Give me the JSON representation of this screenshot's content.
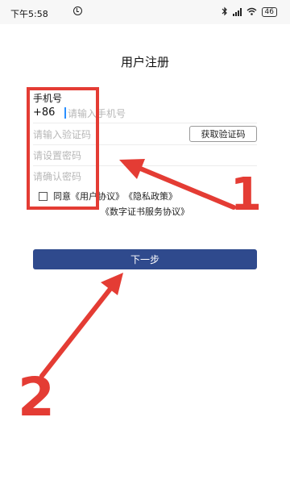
{
  "status_bar": {
    "time": "下午5:58",
    "battery": "46"
  },
  "page": {
    "title": "用户注册"
  },
  "form": {
    "phone_label": "手机号",
    "country_code": "+86",
    "phone_placeholder": "请输入手机号",
    "code_placeholder": "请输入验证码",
    "get_code_label": "获取验证码",
    "password_placeholder": "请设置密码",
    "confirm_placeholder": "请确认密码"
  },
  "agreement": {
    "agree_text": "同意",
    "user_agreement": "《用户协议》",
    "privacy_policy": "《隐私政策》",
    "cert_agreement": "《数字证书服务协议》"
  },
  "next_button_label": "下一步",
  "annotations": {
    "label_1": "1",
    "label_2": "2",
    "color": "#e43c34"
  }
}
